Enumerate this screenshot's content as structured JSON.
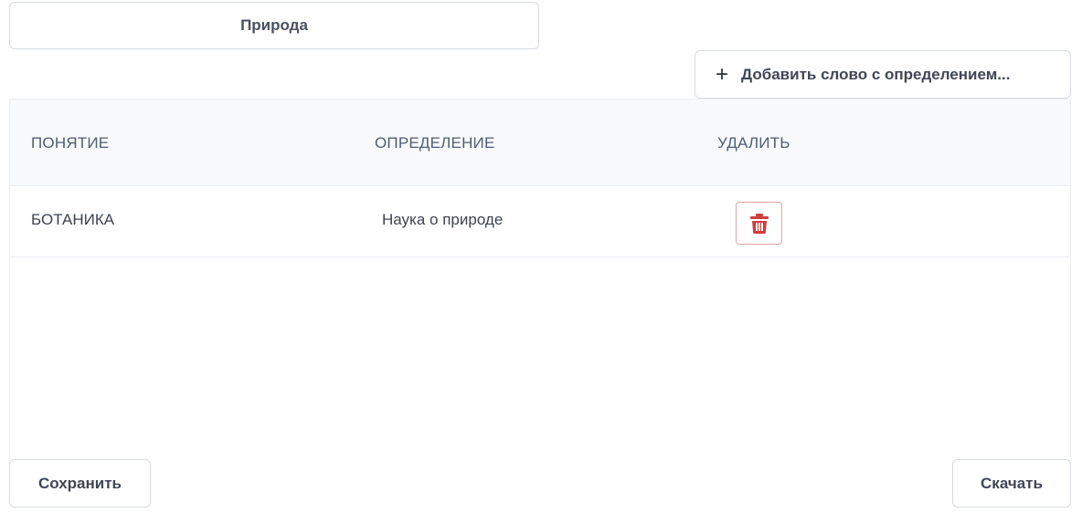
{
  "topic": {
    "value": "Природа"
  },
  "toolbar": {
    "add_label": "Добавить слово с определением...",
    "add_icon": "plus-icon"
  },
  "table": {
    "headers": {
      "term": "ПОНЯТИЕ",
      "definition": "ОПРЕДЕЛЕНИЕ",
      "delete": "УДАЛИТЬ"
    },
    "rows": [
      {
        "term": "БОТАНИКА",
        "definition": "Наука о природе",
        "delete_icon": "trash-icon"
      }
    ]
  },
  "footer": {
    "save_label": "Сохранить",
    "download_label": "Скачать"
  },
  "colors": {
    "delete_accent": "#d23c3c",
    "border": "#d7dbe1",
    "header_bg": "#f8f9fb"
  }
}
